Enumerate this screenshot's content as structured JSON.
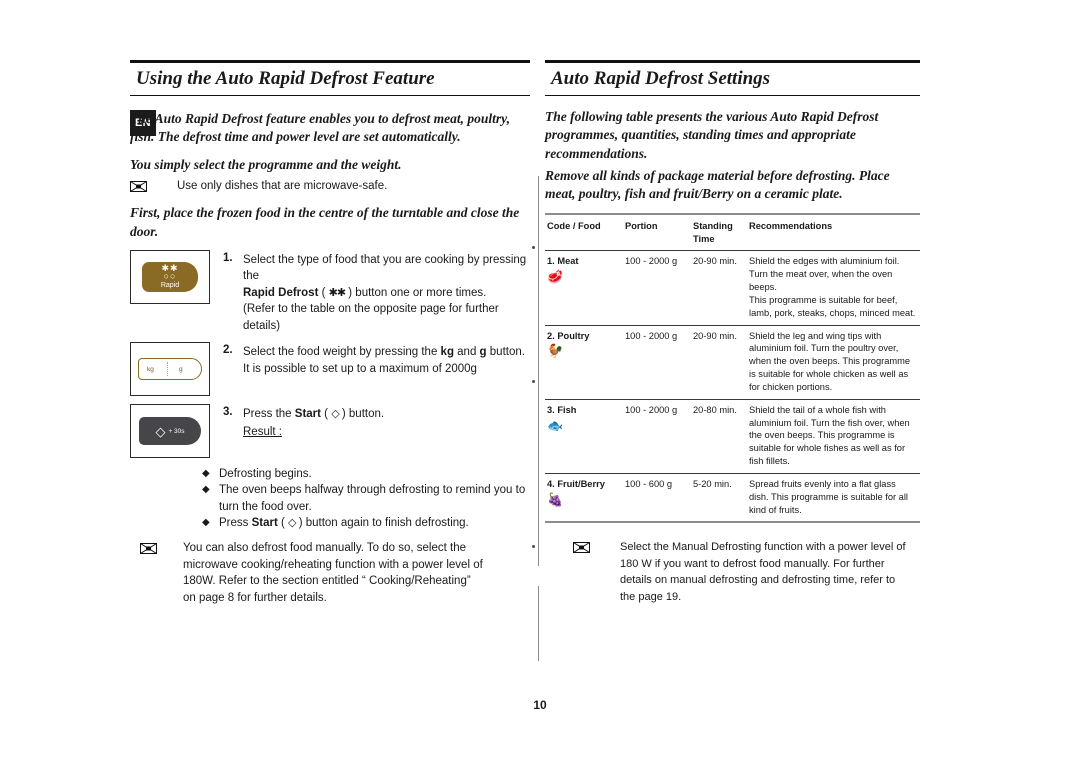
{
  "document": {
    "language_tab": "EN",
    "page_number": "10"
  },
  "left": {
    "heading": "Using the Auto Rapid Defrost Feature",
    "intro_1": "The Auto Rapid Defrost feature enables you to defrost meat, poultry, fish. The defrost time and power level are set automatically.",
    "intro_2": "You simply select the programme and the weight.",
    "note_1": "Use only dishes that are microwave-safe.",
    "intro_3": "First, place the frozen food in the centre of the turntable and close the door.",
    "steps": [
      {
        "num": "1.",
        "button": {
          "name": "rapid-defrost-button",
          "stars": "✱✱",
          "rings": "○○",
          "label": "Rapid"
        },
        "line_1_a": "Select the type of food that you are cooking by pressing the ",
        "line_2_bold": "Rapid Defrost",
        "line_2_glyph": "✱✱",
        "line_2_rest": " ) button one or more times.",
        "line_3": "(Refer to the table on the opposite page for further details)"
      },
      {
        "num": "2.",
        "button": {
          "name": "kg-g-button",
          "kg": "kg",
          "g": "g"
        },
        "line_1_a": "Select the food weight by pressing the ",
        "line_1_b1": "kg",
        "line_1_mid": " and ",
        "line_1_b2": "g",
        "line_1_c": " button.",
        "line_2": "It is possible to set up to a maximum of 2000g"
      },
      {
        "num": "3.",
        "button": {
          "name": "start-button",
          "diamond": "◇",
          "label": "+ 30s"
        },
        "line_1_a": "Press the ",
        "line_1_bold": "Start",
        "line_1_glyph": "◇",
        "line_1_c": " ) button.",
        "result_label": "Result :",
        "results": [
          {
            "text": "Defrosting begins."
          },
          {
            "text": "The oven beeps halfway through defrosting to remind you to turn the food over."
          },
          {
            "text_a": "Press ",
            "bold": "Start",
            "glyph": "◇",
            "text_b": " ) button again to finish defrosting."
          }
        ]
      }
    ],
    "manual_note": "You can also defrost food manually. To do so, select the microwave cooking/reheating function with a power level of 180W. Refer to the section entitled “ Cooking/Reheating” on page 8 for further details."
  },
  "right": {
    "heading": "Auto Rapid Defrost Settings",
    "intro_1": "The following table presents the various Auto Rapid Defrost programmes, quantities, standing times and appropriate recommendations.",
    "intro_2": "Remove all kinds of package material before defrosting. Place meat, poultry, fish and fruit/Berry on a ceramic plate.",
    "table": {
      "headers": [
        "Code / Food",
        "Portion",
        "Standing Time",
        "Recommendations"
      ],
      "rows": [
        {
          "code": "1. Meat",
          "icon": "🥩",
          "icon_name": "meat-icon",
          "portion": "100 - 2000 g",
          "standing": "20-90 min.",
          "recommendation": "Shield the edges with aluminium foil. Turn the meat over, when the oven beeps.\nThis programme is suitable for beef, lamb, pork, steaks, chops, minced meat."
        },
        {
          "code": "2. Poultry",
          "icon": "🐓",
          "icon_name": "poultry-icon",
          "portion": "100 - 2000 g",
          "standing": "20-90 min.",
          "recommendation": "Shield the leg and wing tips with aluminium foil. Turn the poultry over, when the oven beeps. This programme is suitable for whole chicken as well as for chicken portions."
        },
        {
          "code": "3. Fish",
          "icon": "🐟",
          "icon_name": "fish-icon",
          "portion": "100 - 2000 g",
          "standing": "20-80 min.",
          "recommendation": "Shield the tail of a whole fish with aluminium foil. Turn the fish over, when the oven beeps. This programme is suitable for whole fishes as well as for fish fillets."
        },
        {
          "code": "4. Fruit/Berry",
          "icon": "🍇",
          "icon_name": "fruit-berry-icon",
          "portion": "100 - 600 g",
          "standing": "5-20 min.",
          "recommendation": "Spread fruits evenly into a flat glass dish. This programme is suitable for all kind of fruits."
        }
      ]
    },
    "note": "Select the Manual Defrosting function with a power level of 180 W if you want to defrost food manually. For further details on manual defrosting and defrosting time, refer to the page 19."
  },
  "colors": {
    "rapid_button": "#8a6a24",
    "start_button": "#46464a",
    "rule": "#111111",
    "divider": "#8a8a8a"
  }
}
